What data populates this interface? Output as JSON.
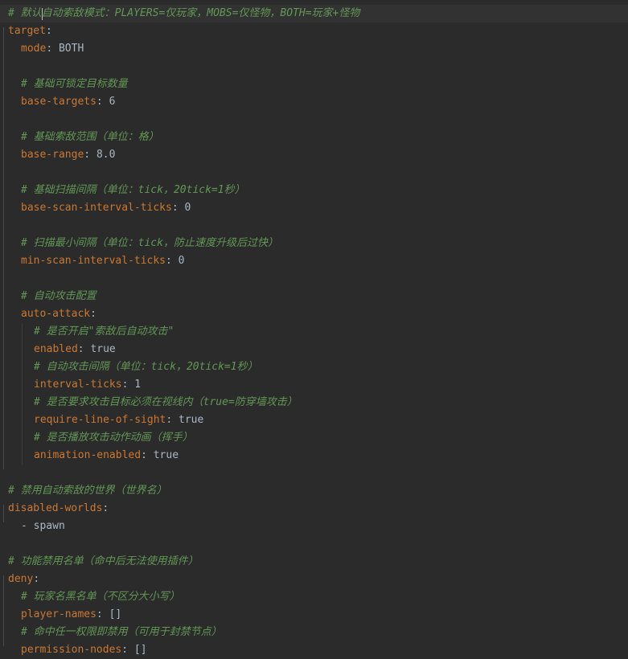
{
  "lines": [
    {
      "type": "comment",
      "indent": 0,
      "text": "# 默认自动索敌模式：PLAYERS=仅玩家，MOBS=仅怪物，BOTH=玩家+怪物"
    },
    {
      "type": "kv",
      "indent": 0,
      "key": "target",
      "value": ""
    },
    {
      "type": "kv",
      "indent": 1,
      "key": "mode",
      "value": "BOTH"
    },
    {
      "type": "blank",
      "indent": 0
    },
    {
      "type": "comment",
      "indent": 1,
      "text": "# 基础可锁定目标数量"
    },
    {
      "type": "kv",
      "indent": 1,
      "key": "base-targets",
      "value": "6"
    },
    {
      "type": "blank",
      "indent": 0
    },
    {
      "type": "comment",
      "indent": 1,
      "text": "# 基础索敌范围（单位：格）"
    },
    {
      "type": "kv",
      "indent": 1,
      "key": "base-range",
      "value": "8.0"
    },
    {
      "type": "blank",
      "indent": 0
    },
    {
      "type": "comment",
      "indent": 1,
      "text": "# 基础扫描间隔（单位：tick，20tick=1秒）"
    },
    {
      "type": "kv",
      "indent": 1,
      "key": "base-scan-interval-ticks",
      "value": "0"
    },
    {
      "type": "blank",
      "indent": 0
    },
    {
      "type": "comment",
      "indent": 1,
      "text": "# 扫描最小间隔（单位：tick，防止速度升级后过快）"
    },
    {
      "type": "kv",
      "indent": 1,
      "key": "min-scan-interval-ticks",
      "value": "0"
    },
    {
      "type": "blank",
      "indent": 0
    },
    {
      "type": "comment",
      "indent": 1,
      "text": "# 自动攻击配置"
    },
    {
      "type": "kv",
      "indent": 1,
      "key": "auto-attack",
      "value": ""
    },
    {
      "type": "comment",
      "indent": 2,
      "text": "# 是否开启\"索敌后自动攻击\""
    },
    {
      "type": "kv",
      "indent": 2,
      "key": "enabled",
      "value": "true"
    },
    {
      "type": "comment",
      "indent": 2,
      "text": "# 自动攻击间隔（单位：tick，20tick=1秒）"
    },
    {
      "type": "kv",
      "indent": 2,
      "key": "interval-ticks",
      "value": "1"
    },
    {
      "type": "comment",
      "indent": 2,
      "text": "# 是否要求攻击目标必须在视线内（true=防穿墙攻击）"
    },
    {
      "type": "kv",
      "indent": 2,
      "key": "require-line-of-sight",
      "value": "true"
    },
    {
      "type": "comment",
      "indent": 2,
      "text": "# 是否播放攻击动作动画（挥手）"
    },
    {
      "type": "kv",
      "indent": 2,
      "key": "animation-enabled",
      "value": "true"
    },
    {
      "type": "blank",
      "indent": 0
    },
    {
      "type": "comment",
      "indent": 0,
      "text": "# 禁用自动索敌的世界（世界名）"
    },
    {
      "type": "kv",
      "indent": 0,
      "key": "disabled-worlds",
      "value": ""
    },
    {
      "type": "listitem",
      "indent": 1,
      "text": "- spawn"
    },
    {
      "type": "blank",
      "indent": 0
    },
    {
      "type": "comment",
      "indent": 0,
      "text": "# 功能禁用名单（命中后无法使用插件）"
    },
    {
      "type": "kv",
      "indent": 0,
      "key": "deny",
      "value": ""
    },
    {
      "type": "comment",
      "indent": 1,
      "text": "# 玩家名黑名单（不区分大小写）"
    },
    {
      "type": "kv",
      "indent": 1,
      "key": "player-names",
      "value": "[]"
    },
    {
      "type": "comment",
      "indent": 1,
      "text": "# 命中任一权限即禁用（可用于封禁节点）"
    },
    {
      "type": "kv",
      "indent": 1,
      "key": "permission-nodes",
      "value": "[]"
    }
  ],
  "colors": {
    "background": "#2b2b2b",
    "current_line": "#323232",
    "key": "#cc7832",
    "comment": "#629755",
    "text": "#a9b7c6"
  }
}
